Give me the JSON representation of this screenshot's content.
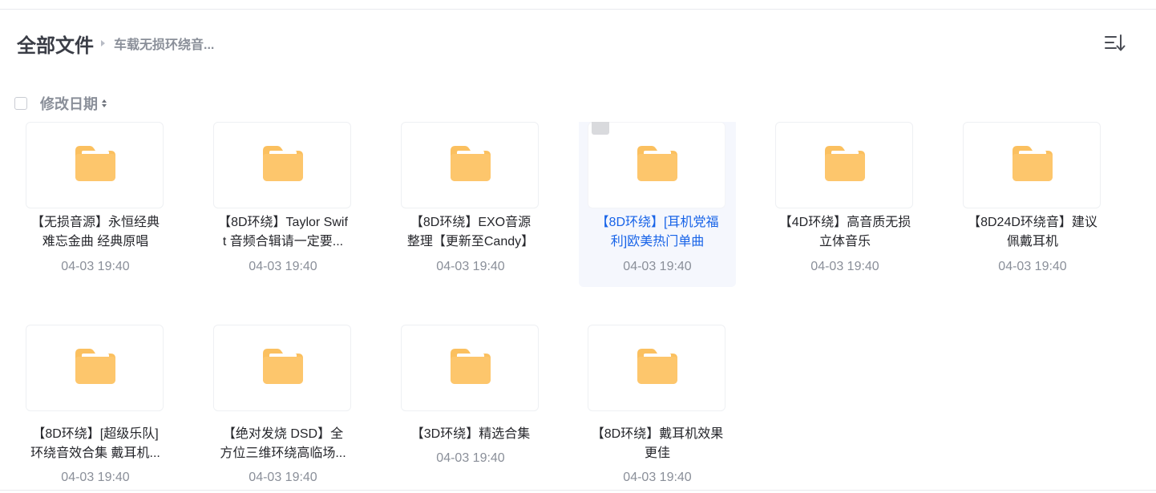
{
  "breadcrumb": {
    "root": "全部文件",
    "current": "车载无损环绕音..."
  },
  "toolbar": {
    "sort_label": "修改日期",
    "sort_icon": "sort-list-icon"
  },
  "colors": {
    "folder": "#fbc05f",
    "selected_bg": "#f5f7fd",
    "selected_text": "#1763e8"
  },
  "files": [
    {
      "line1": "【无损音源】永恒经典",
      "line2": "难忘金曲 经典原唱",
      "date": "04-03 19:40"
    },
    {
      "line1": "【8D环绕】Taylor Swif",
      "line2": "t 音频合辑请一定要...",
      "date": "04-03 19:40"
    },
    {
      "line1": "【8D环绕】EXO音源",
      "line2": "整理【更新至Candy】",
      "date": "04-03 19:40"
    },
    {
      "line1": "【8D环绕】[耳机党福",
      "line2": "利]欧美热门单曲",
      "date": "04-03 19:40",
      "selected": true
    },
    {
      "line1": "【4D环绕】高音质无损",
      "line2": "立体音乐",
      "date": "04-03 19:40"
    },
    {
      "line1": "【8D24D环绕音】建议",
      "line2": "佩戴耳机",
      "date": "04-03 19:40"
    },
    {
      "line1": "【8D环绕】[超级乐队]",
      "line2": "环绕音效合集 戴耳机...",
      "date": "04-03 19:40"
    },
    {
      "line1": "【绝对发烧 DSD】全",
      "line2": "方位三维环绕高临场...",
      "date": "04-03 19:40"
    },
    {
      "line1": "【3D环绕】精选合集",
      "line2": "",
      "date": "04-03 19:40"
    },
    {
      "line1": "【8D环绕】戴耳机效果",
      "line2": "更佳",
      "date": "04-03 19:40"
    }
  ]
}
